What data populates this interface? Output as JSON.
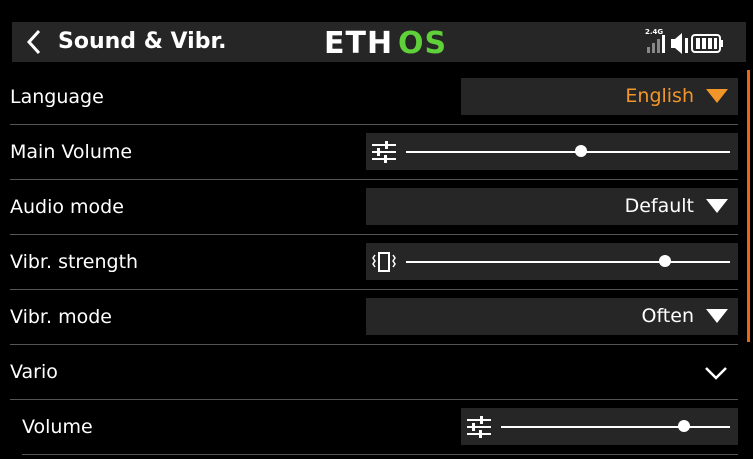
{
  "header": {
    "title": "Sound & Vibr.",
    "logo_text": "ETHOS",
    "signal_label": "2.4G"
  },
  "colors": {
    "accent": "#f2962a",
    "scroll": "#e8661a",
    "field_bg": "#262626",
    "logo_green": "#5fcf3a"
  },
  "rows": {
    "language": {
      "label": "Language",
      "value": "English"
    },
    "main_volume": {
      "label": "Main Volume",
      "level": 0.54
    },
    "audio_mode": {
      "label": "Audio mode",
      "value": "Default"
    },
    "vibr_strength": {
      "label": "Vibr. strength",
      "level": 0.8
    },
    "vibr_mode": {
      "label": "Vibr. mode",
      "value": "Often"
    },
    "vario": {
      "label": "Vario"
    },
    "vario_volume": {
      "label": "Volume",
      "level": 0.8
    }
  }
}
